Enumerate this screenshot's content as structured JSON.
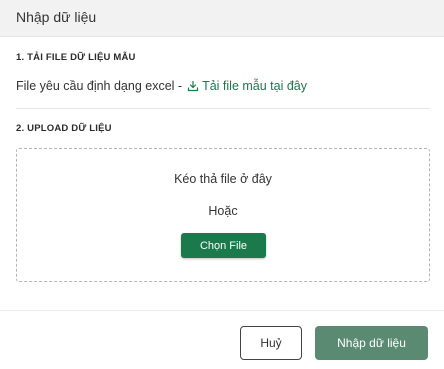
{
  "dialog": {
    "title": "Nhập dữ liệu"
  },
  "template_section": {
    "title": "1. TẢI FILE DỮ LIỆU MẪU",
    "requirement_text": "File yêu cầu định dạng excel -",
    "download_link_label": "Tải file mẫu tại đây",
    "download_icon": "download-icon"
  },
  "upload_section": {
    "title": "2. UPLOAD DỮ LIỆU",
    "drop_text": "Kéo thả file ở đây",
    "or_text": "Hoặc",
    "choose_button_label": "Chọn File"
  },
  "footer": {
    "cancel_label": "Huỷ",
    "submit_label": "Nhập dữ liệu"
  },
  "colors": {
    "accent": "#1a7a4c",
    "submit_button": "#5a8a72",
    "header_bg": "#f2f2f2"
  }
}
